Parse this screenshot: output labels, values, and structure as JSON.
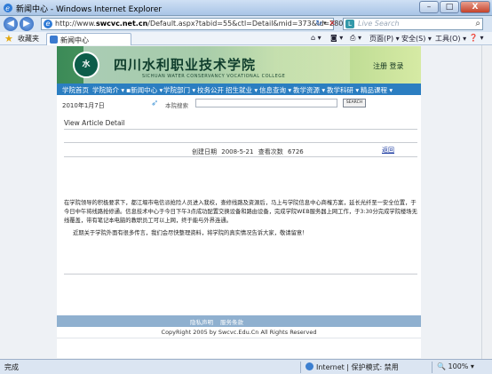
{
  "window": {
    "title": "新闻中心 - Windows Internet Explorer",
    "minimize": "–",
    "maximize": "□",
    "close": "X"
  },
  "address": {
    "url_prefix": "http://www.",
    "url_host": "swcvc.net.cn",
    "url_path": "/Default.aspx?tabid=55&ctl=Detail&mid=373&Id=280",
    "search_placeholder": "Live Search"
  },
  "favorites": {
    "label": "收藏夹",
    "tab_title": "新闻中心"
  },
  "commands": {
    "page": "页面(P) ▾",
    "safety": "安全(S) ▾",
    "tools": "工具(O) ▾",
    "help": "❓ ▾"
  },
  "site": {
    "logo_text": "水",
    "title_cn": "四川水利职业技术学院",
    "title_en": "SICHUAN WATER CONSERVANCY VOCATIONAL COLLEGE",
    "login": "注册 登录",
    "menu": [
      "学院首页",
      "学院简介 ▾",
      "▪新闻中心 ▾",
      "学院部门 ▾",
      "校务公开",
      "招生就业 ▾",
      "信息查询 ▾",
      "教学资源 ▾",
      "教学科研 ▾",
      "精品课程 ▾"
    ],
    "date": "2010年1月7日",
    "search_label": "本院搜索",
    "search_button": "SEARCH"
  },
  "article": {
    "heading": "View Article Detail",
    "created_label": "创建日期",
    "created_date": "2008-5-21",
    "views_label": "查看次数",
    "views": "6726",
    "back": "返回",
    "paragraph1": "在学院领导的积极要求下，都江堰市电信派抢险人员进入我校，查修线路及资源后，马上与学院信息中心商榷方案，延长光纤至一安全位置，于今日中午将线路抢修通。信息技术中心于今日下午3点成功配置交换设备和路由设备，完成学院WEB服务器上网工作，于3:30分完成学院楼场无线覆盖，带有笔记本电脑的教职员工可以上网，终于能与外界连通。",
    "paragraph2": "近期关于学院外面有很多传言，我们会尽快整理资料，将学院的真实情况告诉大家，敬请留意！"
  },
  "footer": {
    "links": [
      "隐私声明",
      "服务条款"
    ],
    "copyright": "CopyRight 2005 by Swcvc.Edu.Cn All Rights Reserved"
  },
  "status": {
    "text": "完成",
    "zone": "Internet | 保护模式: 禁用",
    "zoom": "100%"
  }
}
